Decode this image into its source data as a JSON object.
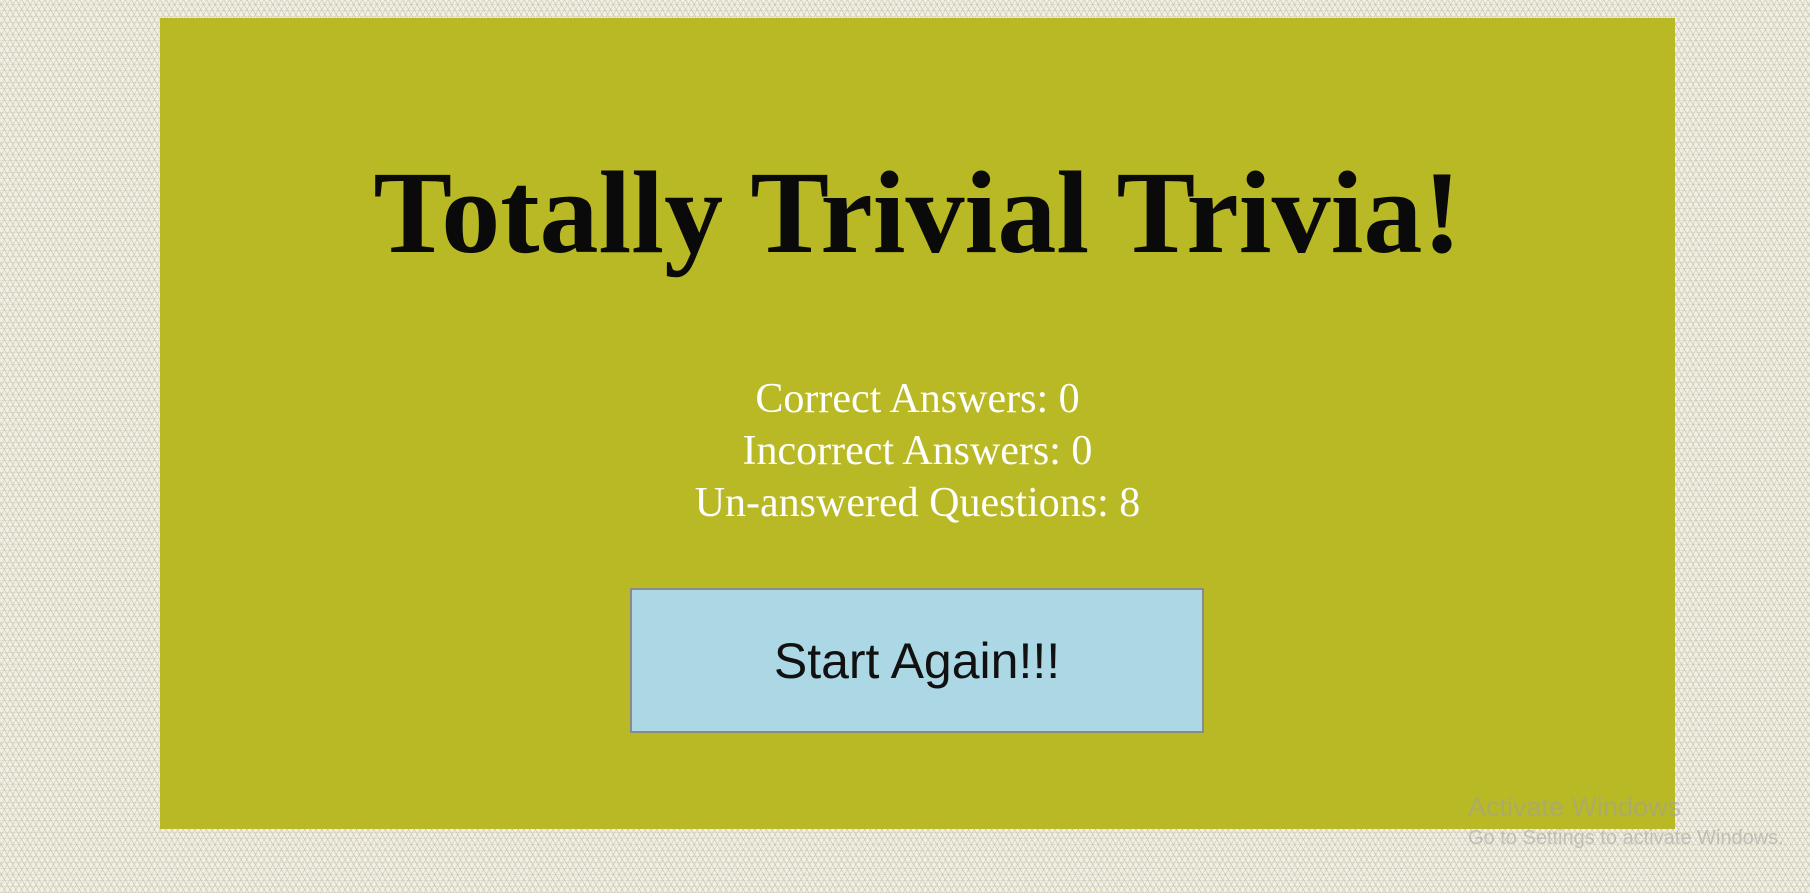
{
  "game": {
    "title": "Totally Trivial Trivia!",
    "stats": {
      "correct": "Correct Answers: 0",
      "incorrect": "Incorrect Answers: 0",
      "unanswered": "Un-answered Questions: 8"
    },
    "restart_label": "Start Again!!!"
  },
  "watermark": {
    "title": "Activate Windows",
    "subtitle": "Go to Settings to activate Windows."
  },
  "colors": {
    "panel": "#b8b925",
    "button": "#acd8e5",
    "stats_text": "#ffffff",
    "title_text": "#0a0a0a"
  }
}
